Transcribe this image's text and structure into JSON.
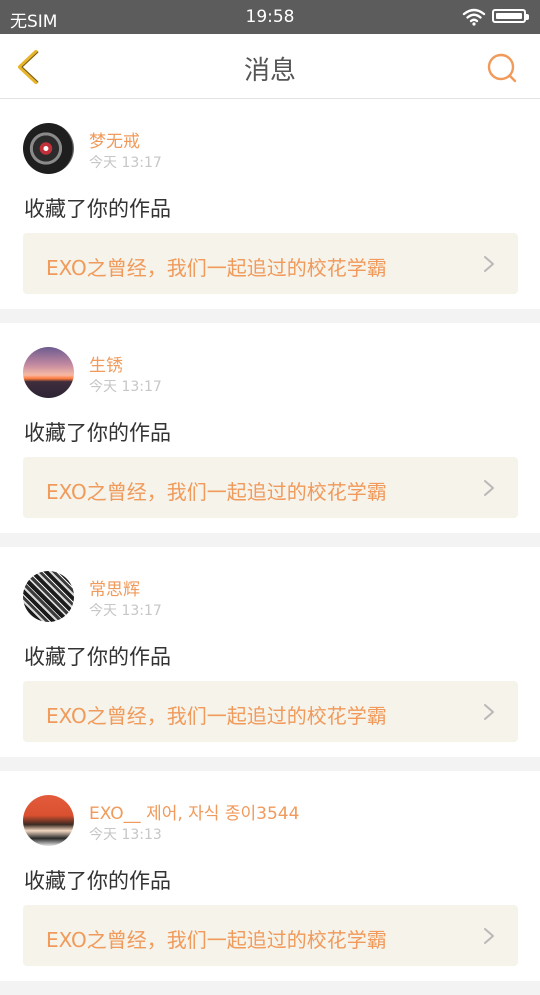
{
  "status_bar": {
    "carrier": "无SIM",
    "time": "19:58"
  },
  "header": {
    "title": "消息",
    "back_icon": "chevron-left-icon",
    "search_icon": "search-icon"
  },
  "colors": {
    "accent": "#f09a5b",
    "back_icon": "#e8b52a",
    "card_link_bg": "#f6f3ea"
  },
  "messages": [
    {
      "name": "梦无戒",
      "time": "今天 13:17",
      "action": "收藏了你的作品",
      "work_title": "EXO之曾经，我们一起追过的校花学霸"
    },
    {
      "name": "生锈",
      "time": "今天 13:17",
      "action": "收藏了你的作品",
      "work_title": "EXO之曾经，我们一起追过的校花学霸"
    },
    {
      "name": "常思辉",
      "time": "今天 13:17",
      "action": "收藏了你的作品",
      "work_title": "EXO之曾经，我们一起追过的校花学霸"
    },
    {
      "name": "EXO__ 제어, 자식 종이3544",
      "time": "今天 13:13",
      "action": "收藏了你的作品",
      "work_title": "EXO之曾经，我们一起追过的校花学霸"
    }
  ]
}
